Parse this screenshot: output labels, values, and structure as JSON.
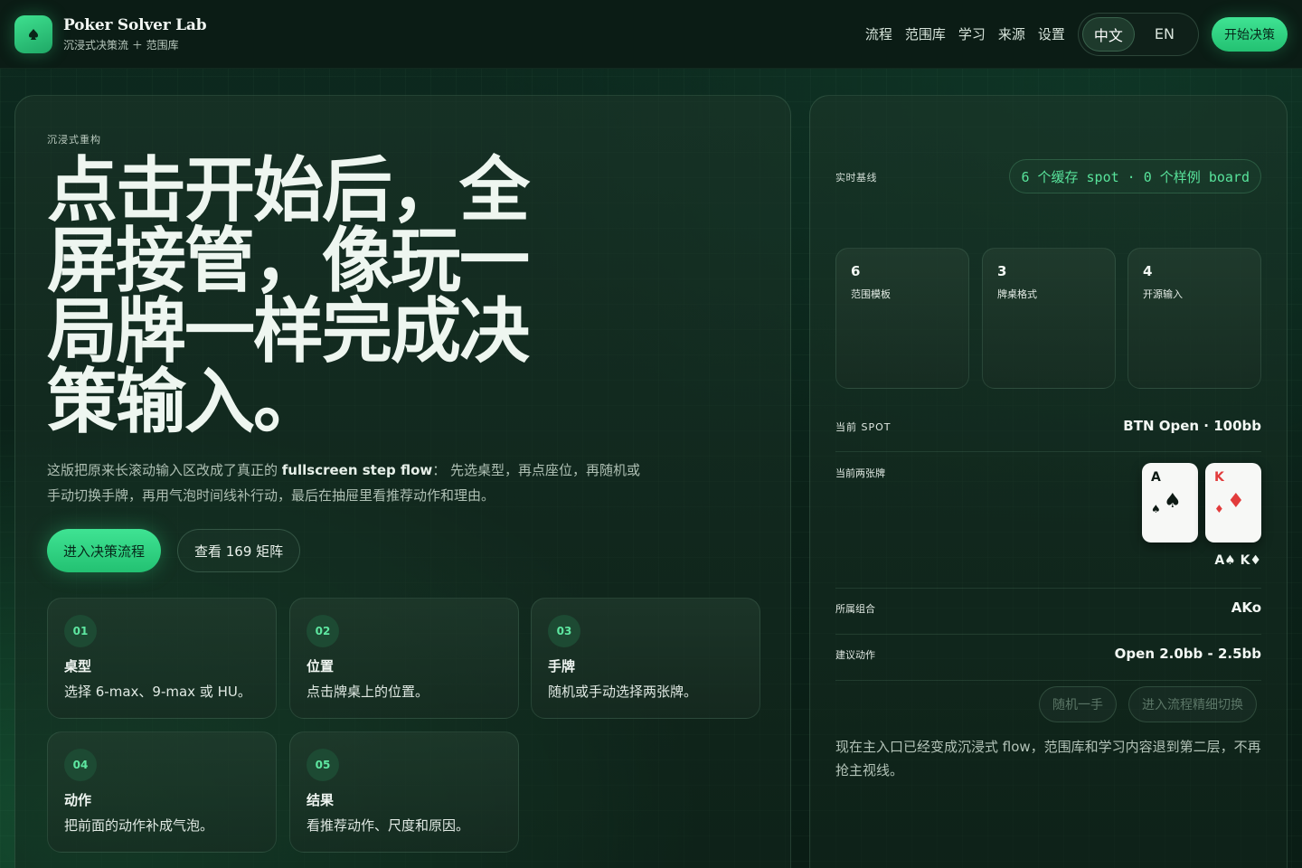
{
  "header": {
    "brand_title": "Poker Solver Lab",
    "brand_subtitle": "沉浸式决策流 ＋ 范围库",
    "nav": [
      "流程",
      "范围库",
      "学习",
      "来源",
      "设置"
    ],
    "lang": {
      "zh": "中文",
      "en": "EN",
      "active": "zh"
    },
    "start_label": "开始决策"
  },
  "hero": {
    "eyebrow": "沉浸式重构",
    "headline": "点击开始后，全屏接管，像玩一局牌一样完成决策输入。",
    "desc_before": "这版把原来长滚动输入区改成了真正的 ",
    "desc_bold": "fullscreen step flow",
    "desc_after": "： 先选桌型，再点座位，再随机或手动切换手牌，再用气泡时间线补行动，最后在抽屉里看推荐动作和理由。",
    "cta_primary": "进入决策流程",
    "cta_secondary": "查看 169 矩阵"
  },
  "steps": [
    {
      "num": "01",
      "title": "桌型",
      "text": "选择 6-max、9-max 或 HU。"
    },
    {
      "num": "02",
      "title": "位置",
      "text": "点击牌桌上的位置。"
    },
    {
      "num": "03",
      "title": "手牌",
      "text": "随机或手动选择两张牌。"
    },
    {
      "num": "04",
      "title": "动作",
      "text": "把前面的动作补成气泡。"
    },
    {
      "num": "05",
      "title": "结果",
      "text": "看推荐动作、尺度和原因。"
    }
  ],
  "baseline": {
    "label": "实时基线",
    "pill": "6 个缓存 spot · 0 个样例 board"
  },
  "stats": [
    {
      "num": "6",
      "label": "范围模板"
    },
    {
      "num": "3",
      "label": "牌桌格式"
    },
    {
      "num": "4",
      "label": "开源输入"
    }
  ],
  "spot": {
    "current_spot_label": "当前 SPOT",
    "current_spot_value": "BTN Open · 100bb",
    "hole_cards_label": "当前两张牌",
    "cards": [
      {
        "rank": "A",
        "suit": "♠",
        "color": "#0e1a14"
      },
      {
        "rank": "K",
        "suit": "♦",
        "color": "#e23c3c"
      }
    ],
    "hand_text": "A♠ K♦",
    "combo_label": "所属组合",
    "combo_value": "AKo",
    "action_label": "建议动作",
    "action_value": "Open 2.0bb - 2.5bb",
    "random_btn": "随机一手",
    "refine_btn": "进入流程精细切换",
    "note": "现在主入口已经变成沉浸式 flow，范围库和学习内容退到第二层，不再抢主视线。"
  },
  "colors": {
    "accent": "#3fe393",
    "bg": "#0b2219",
    "accent_text": "#58e39b"
  }
}
